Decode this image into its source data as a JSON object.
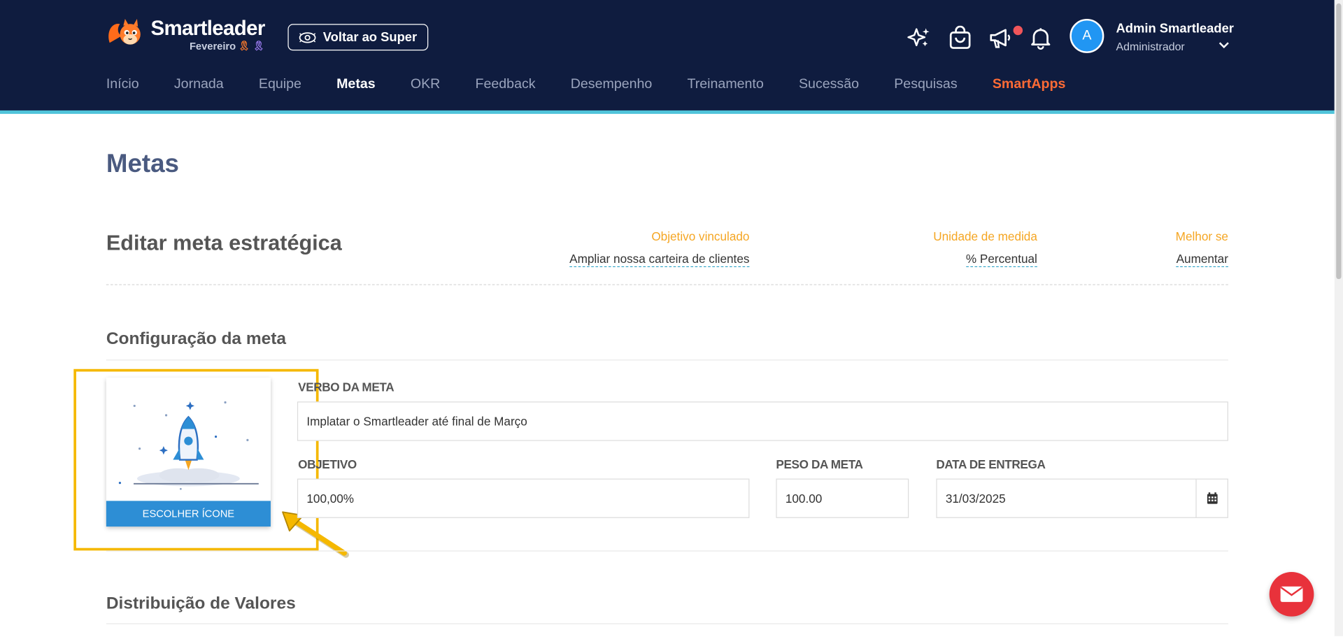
{
  "header": {
    "logo": {
      "name": "Smartleader",
      "month": "Fevereiro",
      "ribbon_orange": "🎗",
      "ribbon_purple": "🎗"
    },
    "back_button": "Voltar ao Super",
    "icons": [
      "sparkle-icon",
      "shopping-bag-icon",
      "megaphone-icon",
      "bell-icon"
    ],
    "user": {
      "avatar_initial": "A",
      "name": "Admin Smartleader",
      "role": "Administrador"
    },
    "nav": [
      {
        "label": "Início"
      },
      {
        "label": "Jornada"
      },
      {
        "label": "Equipe"
      },
      {
        "label": "Metas",
        "active": true
      },
      {
        "label": "OKR"
      },
      {
        "label": "Feedback"
      },
      {
        "label": "Desempenho"
      },
      {
        "label": "Treinamento"
      },
      {
        "label": "Sucessão"
      },
      {
        "label": "Pesquisas"
      },
      {
        "label": "SmartApps"
      }
    ]
  },
  "page": {
    "title": "Metas",
    "edit_title": "Editar meta estratégica",
    "summary": {
      "objective": {
        "label": "Objetivo vinculado",
        "value": "Ampliar nossa carteira de clientes"
      },
      "unit": {
        "label": "Unidade de medida",
        "value": "% Percentual"
      },
      "better_if": {
        "label": "Melhor se",
        "value": "Aumentar"
      }
    },
    "config_section": {
      "title": "Configuração da meta",
      "choose_icon": "ESCOLHER ÍCONE",
      "verb_label": "VERBO DA META",
      "verb_value": "Implatar o Smartleader até final de Março",
      "objective_label": "OBJETIVO",
      "objective_value": "100,00%",
      "weight_label": "PESO DA META",
      "weight_value": "100.00",
      "due_label": "DATA DE ENTREGA",
      "due_value": "31/03/2025"
    },
    "distribution_section": {
      "title": "Distribuição de Valores"
    }
  },
  "colors": {
    "header_bg": "#0f1c3f",
    "accent_stripe": "#4fc3d9",
    "smartapps": "#ff6b35",
    "summary_label": "#f5a623",
    "highlight": "#f5b800",
    "choose_icon_btn": "#2d8ed5",
    "fab": "#e8323b"
  }
}
